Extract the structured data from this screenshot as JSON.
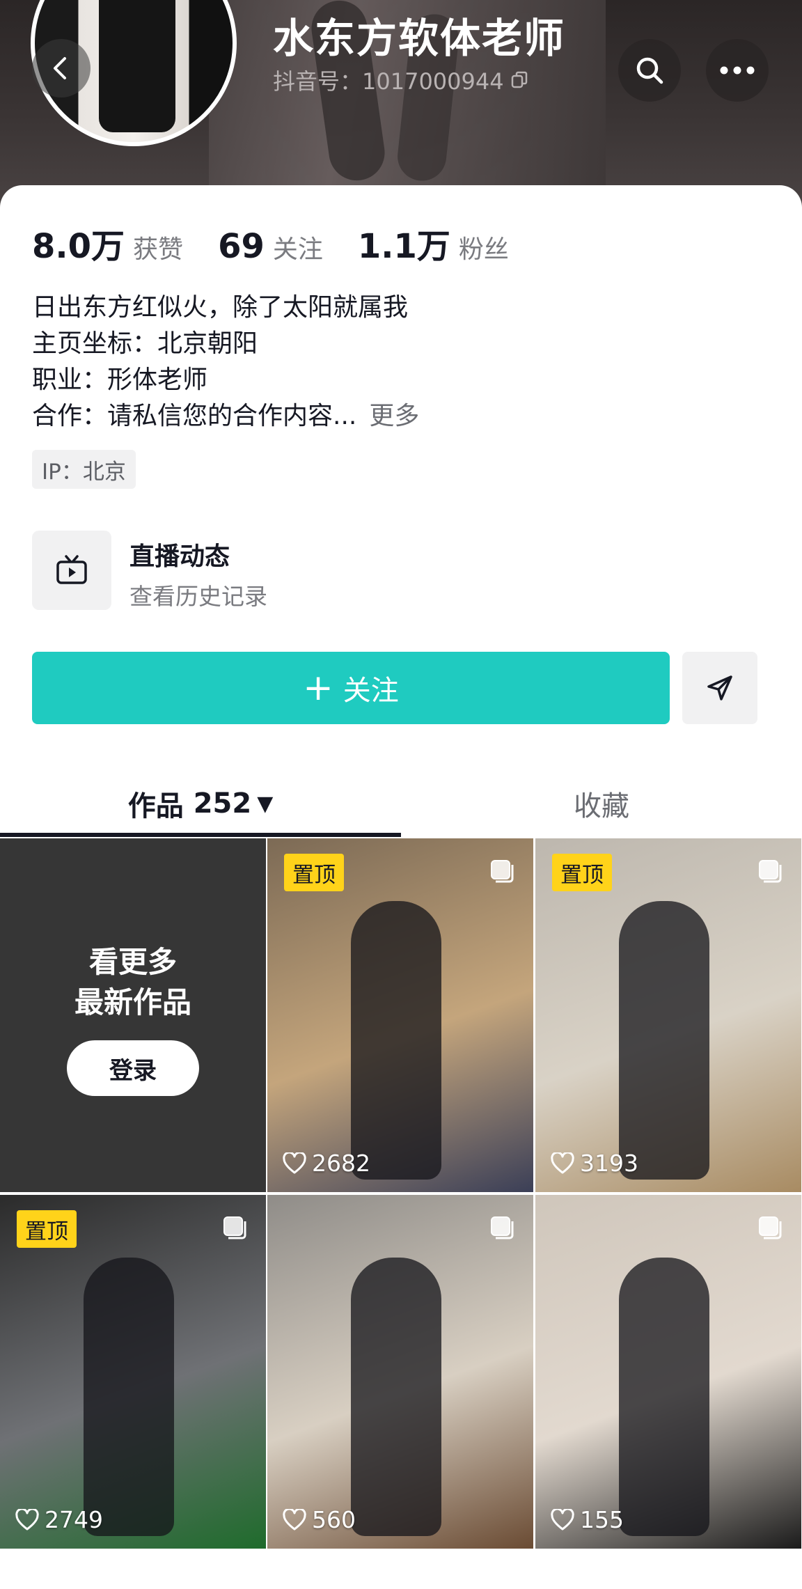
{
  "profile": {
    "name": "水东方软体老师",
    "account_id": "抖音号：1017000944"
  },
  "stats": [
    {
      "value": "8.0万",
      "label": "获赞"
    },
    {
      "value": "69",
      "label": "关注"
    },
    {
      "value": "1.1万",
      "label": "粉丝"
    }
  ],
  "bio": {
    "lines": [
      "日出东方红似火，除了太阳就属我",
      "主页坐标：北京朝阳",
      "职业：形体老师",
      "合作：请私信您的合作内容..."
    ],
    "more_label": "更多"
  },
  "ip_tag": "IP：北京",
  "live": {
    "title": "直播动态",
    "subtitle": "查看历史记录"
  },
  "actions": {
    "follow_label": "关注"
  },
  "tabs": {
    "works_label": "作品",
    "works_count": "252",
    "favorites_label": "收藏"
  },
  "login_prompt": {
    "line1": "看更多",
    "line2": "最新作品",
    "button": "登录"
  },
  "pinned_label": "置顶",
  "videos": [
    {
      "pinned": true,
      "likes": "2682",
      "colors": [
        "#7c6a55",
        "#c4a57c",
        "#3b3f57"
      ]
    },
    {
      "pinned": true,
      "likes": "3193",
      "colors": [
        "#bdb7ae",
        "#d9d2c6",
        "#a88b62"
      ]
    },
    {
      "pinned": true,
      "likes": "2749",
      "colors": [
        "#2b2b2b",
        "#6f7175",
        "#1f6b2c"
      ]
    },
    {
      "pinned": false,
      "likes": "560",
      "colors": [
        "#8f8c88",
        "#d8cfc2",
        "#6a4b33"
      ]
    },
    {
      "pinned": false,
      "likes": "155",
      "colors": [
        "#cfc6bb",
        "#e2d9cf",
        "#1b1b1b"
      ]
    }
  ],
  "icons": [
    "back-icon",
    "search-icon",
    "more-icon",
    "copy-icon",
    "tv-icon",
    "plus-icon",
    "send-icon",
    "caret-down-icon",
    "heart-icon",
    "select-icon"
  ],
  "accent_color": "#1fcbc0",
  "pin_color": "#ffd31a"
}
